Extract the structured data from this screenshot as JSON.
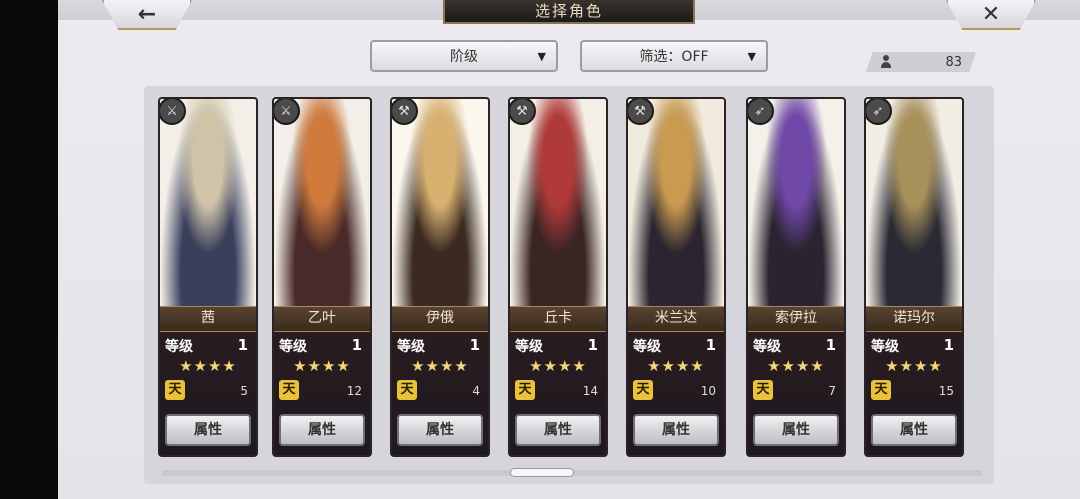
{
  "header": {
    "title": "选择角色",
    "back_icon": "←",
    "close_icon": "✕"
  },
  "filters": {
    "class_label": "阶级",
    "filter_label": "筛选：OFF",
    "arrow": "▼"
  },
  "roster": {
    "count": "83"
  },
  "cards": [
    {
      "name": "茜",
      "level_label": "等级",
      "level": "1",
      "stars": "★★★★",
      "rank_badge": "天",
      "rank_value": "5",
      "attr_label": "属性",
      "class_icon": "⚔",
      "colors": [
        "#f3efe8",
        "#cfc4a8",
        "#3a3f5c"
      ]
    },
    {
      "name": "乙叶",
      "level_label": "等级",
      "level": "1",
      "stars": "★★★★",
      "rank_badge": "天",
      "rank_value": "12",
      "attr_label": "属性",
      "class_icon": "⚔",
      "colors": [
        "#f3efe8",
        "#d07a3c",
        "#4a2a28"
      ]
    },
    {
      "name": "伊俄",
      "level_label": "等级",
      "level": "1",
      "stars": "★★★★",
      "rank_badge": "天",
      "rank_value": "4",
      "attr_label": "属性",
      "class_icon": "⚒",
      "colors": [
        "#fbf7ee",
        "#d8b070",
        "#3a2a20"
      ]
    },
    {
      "name": "丘卡",
      "level_label": "等级",
      "level": "1",
      "stars": "★★★★",
      "rank_badge": "天",
      "rank_value": "14",
      "attr_label": "属性",
      "class_icon": "⚒",
      "colors": [
        "#f4efe6",
        "#b03a3a",
        "#3a2424"
      ]
    },
    {
      "name": "米兰达",
      "level_label": "等级",
      "level": "1",
      "stars": "★★★★",
      "rank_badge": "天",
      "rank_value": "10",
      "attr_label": "属性",
      "class_icon": "⚒",
      "colors": [
        "#f1ebdf",
        "#c99a50",
        "#2a2530"
      ]
    },
    {
      "name": "索伊拉",
      "level_label": "等级",
      "level": "1",
      "stars": "★★★★",
      "rank_badge": "天",
      "rank_value": "7",
      "attr_label": "属性",
      "class_icon": "➶",
      "colors": [
        "#f4f0ea",
        "#7048a8",
        "#2a2430"
      ]
    },
    {
      "name": "诺玛尔",
      "level_label": "等级",
      "level": "1",
      "stars": "★★★★",
      "rank_badge": "天",
      "rank_value": "15",
      "attr_label": "属性",
      "class_icon": "➶",
      "colors": [
        "#f2eee6",
        "#a8905a",
        "#2a2a34"
      ]
    }
  ]
}
